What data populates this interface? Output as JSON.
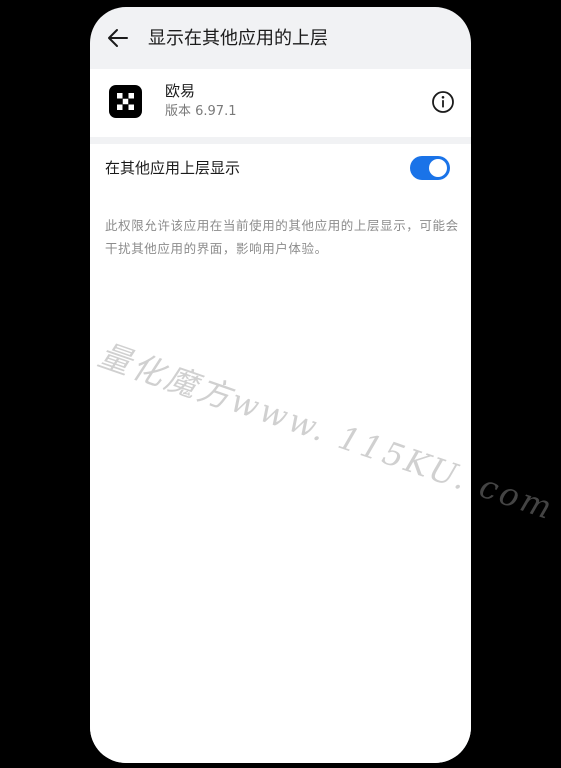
{
  "header": {
    "title": "显示在其他应用的上层",
    "back_icon": "arrow-left-icon"
  },
  "app": {
    "name": "欧易",
    "version": "版本 6.97.1",
    "icon": "okx-logo-icon",
    "info_icon": "info-circle-icon"
  },
  "permission": {
    "label": "在其他应用上层显示",
    "enabled": true,
    "description": "此权限允许该应用在当前使用的其他应用的上层显示，可能会干扰其他应用的界面，影响用户体验。"
  },
  "watermark": {
    "text": "量化魔方www. 115KU. com"
  },
  "colors": {
    "accent": "#1a73e8",
    "background": "#f1f2f4",
    "card": "#ffffff",
    "primary_text": "#1b1b1b",
    "secondary_text": "#8c8c8c"
  }
}
